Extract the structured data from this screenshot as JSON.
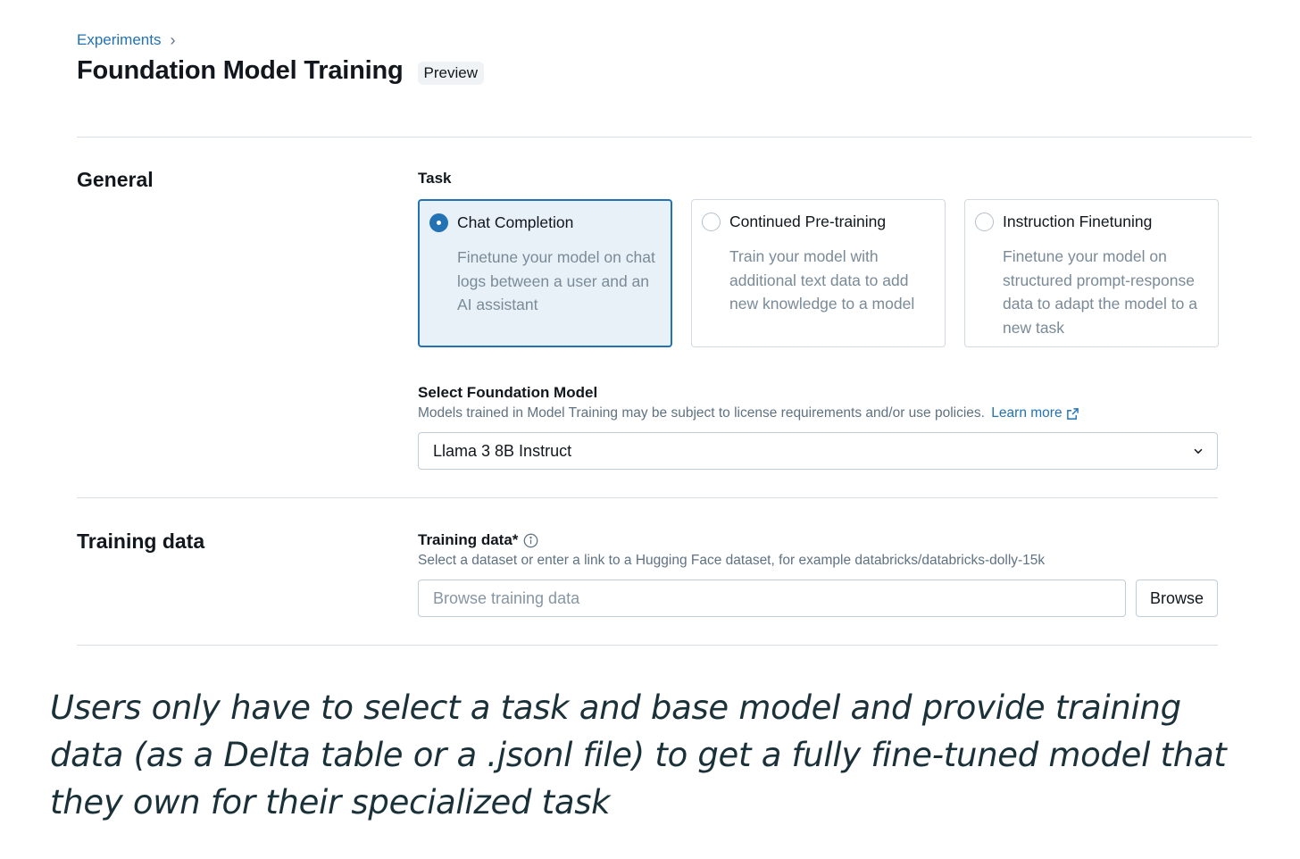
{
  "breadcrumb": {
    "link": "Experiments",
    "separator": "›"
  },
  "page": {
    "title": "Foundation Model Training",
    "badge": "Preview"
  },
  "general": {
    "heading": "General",
    "task_label": "Task",
    "tasks": [
      {
        "title": "Chat Completion",
        "description": "Finetune your model on chat logs between a user and an AI assistant",
        "selected": true
      },
      {
        "title": "Continued Pre-training",
        "description": "Train your model with additional text data to add new knowledge to a model",
        "selected": false
      },
      {
        "title": "Instruction Finetuning",
        "description": "Finetune your model on structured prompt-response data to adapt the model to a new task",
        "selected": false
      }
    ],
    "model_label": "Select Foundation Model",
    "model_help": "Models trained in Model Training may be subject to license requirements and/or use policies.",
    "learn_more": "Learn more",
    "model_value": "Llama 3 8B Instruct"
  },
  "training": {
    "heading": "Training data",
    "label": "Training data*",
    "help": "Select a dataset or enter a link to a Hugging Face dataset, for example databricks/databricks-dolly-15k",
    "placeholder": "Browse training data",
    "browse": "Browse"
  },
  "caption": "Users only have to select a task and base model and provide training data (as a Delta table or a .jsonl file) to get a fully fine-tuned model that they own for their specialized task",
  "colors": {
    "accent": "#2272b4",
    "selected_bg": "#e9f1f8",
    "muted_text": "#5f7281",
    "caption": "#1b3139"
  },
  "icons": [
    "chevron-right-icon",
    "radio-checked-icon",
    "radio-unchecked-icon",
    "external-link-icon",
    "chevron-down-icon",
    "info-icon"
  ]
}
